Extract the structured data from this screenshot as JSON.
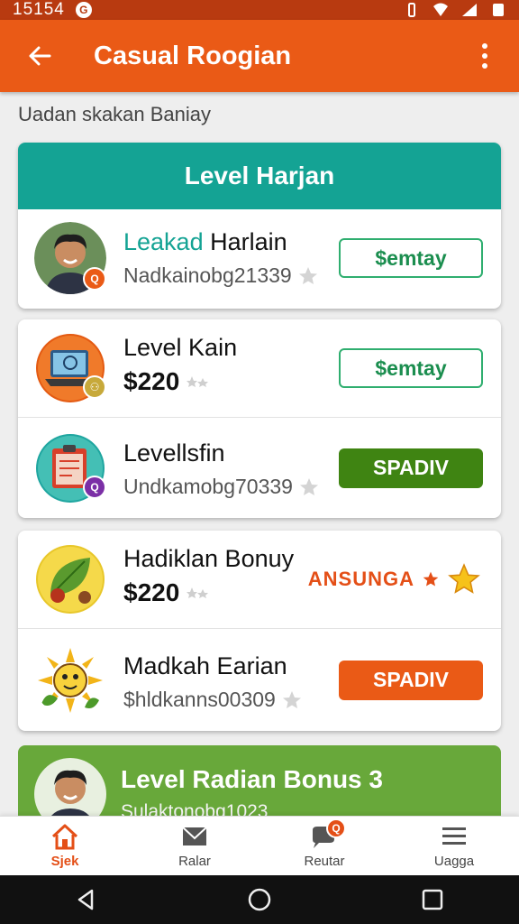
{
  "status_bar": {
    "time": "15154",
    "notif_glyph": "G"
  },
  "app_bar": {
    "title": "Casual Roogian"
  },
  "subtitle": "Uadan skakan Baniay",
  "card1": {
    "header": "Level Harjan",
    "row": {
      "name_accent": "Leakad",
      "name_rest": " Harlain",
      "sub": "Nadkainobg21339",
      "button": "$emtay"
    }
  },
  "card2": {
    "rows": [
      {
        "name": "Level Kain",
        "price": "$220",
        "button": "$emtay"
      },
      {
        "name": "Levellsfin",
        "sub": "Undkamobg70339",
        "button": "SPADIV"
      }
    ]
  },
  "card3": {
    "rows": [
      {
        "name": "Hadiklan Bonuy",
        "price": "$220",
        "promo": "ANSUNGA"
      },
      {
        "name": "Madkah Earian",
        "sub": "$hldkanns00309",
        "button": "SPADIV"
      }
    ]
  },
  "card4": {
    "title": "Level Radian Bonus 3",
    "sub": "Sulaktonobg1023"
  },
  "bottom_nav": {
    "items": [
      "Sjek",
      "Ralar",
      "Reutar",
      "Uagga"
    ],
    "active_index": 0
  },
  "colors": {
    "brand": "#ea5a16",
    "teal": "#14a394",
    "green": "#3f8412",
    "accent_green": "#68a83a"
  },
  "icons": {
    "back": "arrow-left-icon",
    "more": "more-vertical-icon",
    "star": "star-icon",
    "home": "home-icon",
    "mail": "mail-icon",
    "chat": "chat-icon",
    "menu": "menu-icon"
  }
}
